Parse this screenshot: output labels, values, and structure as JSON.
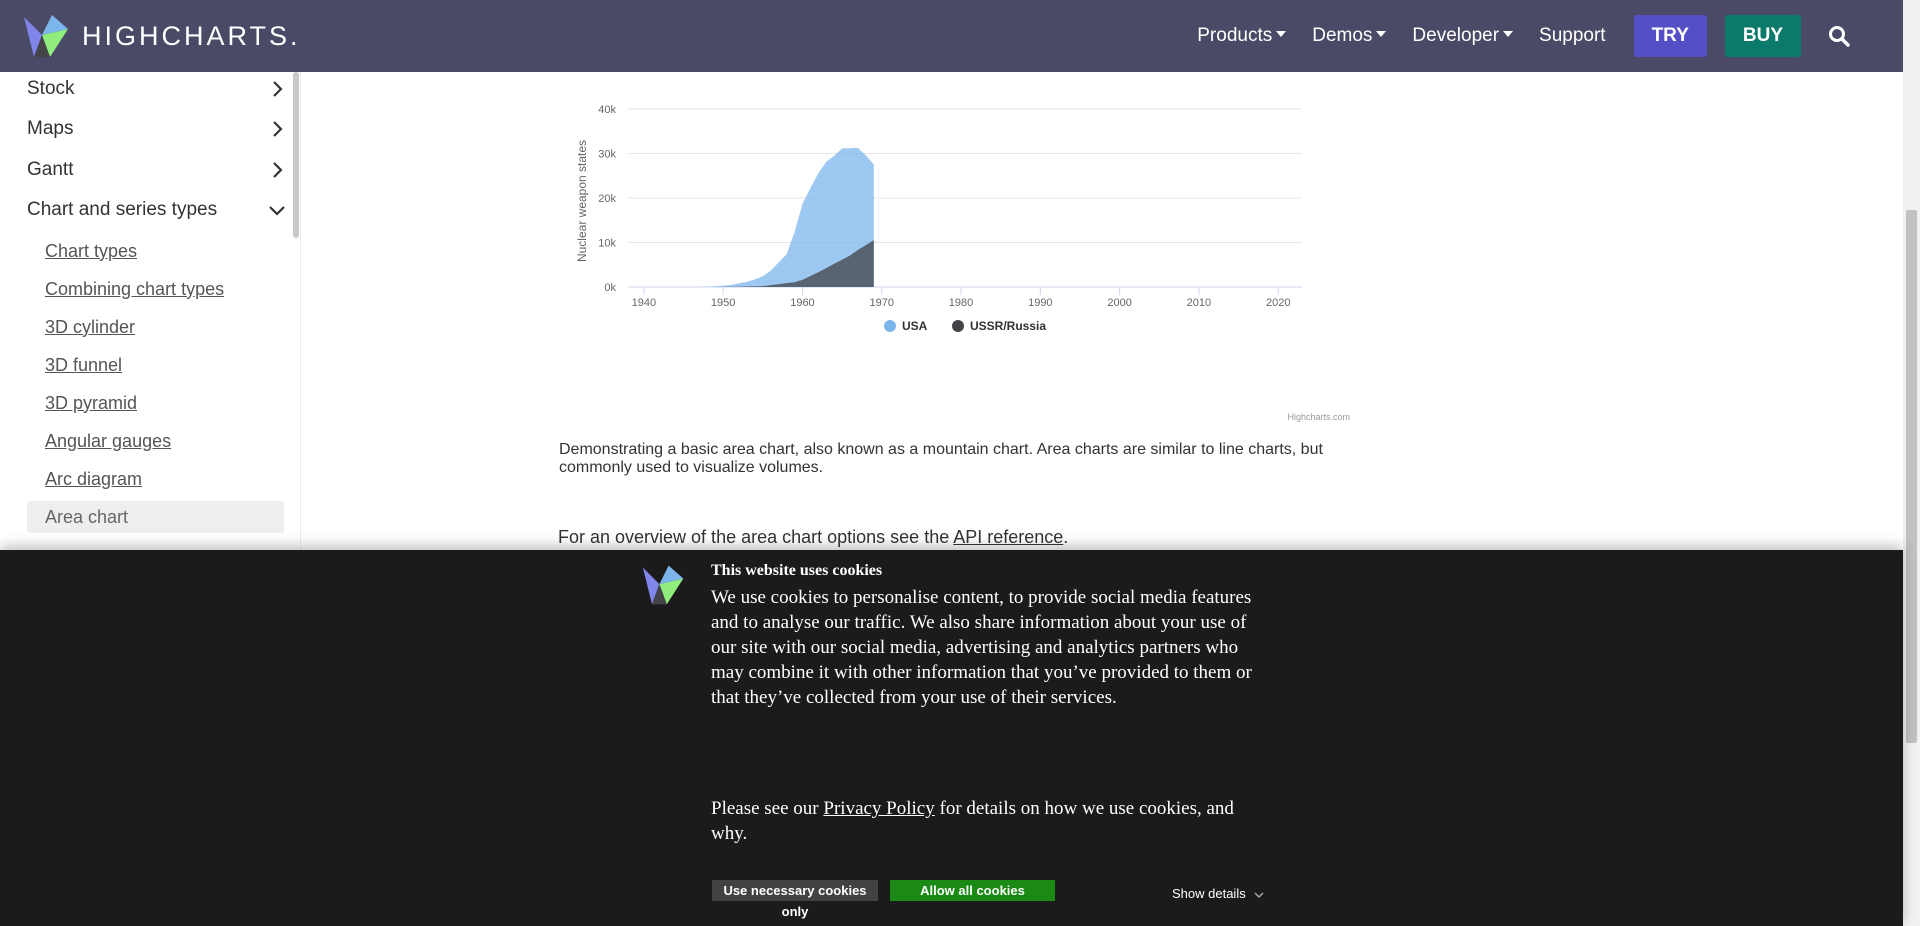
{
  "colors": {
    "nav_bg": "#4a4a67",
    "try_bg": "#544fc5",
    "buy_bg": "#0b7a6a",
    "cookie_bg": "#1b1b1b",
    "allow_bg": "#1a8a14",
    "usa": "#7cb5ec",
    "ussr": "#434348"
  },
  "header": {
    "logo_text": "HIGHCHARTS.",
    "nav": [
      {
        "label": "Products",
        "dropdown": true
      },
      {
        "label": "Demos",
        "dropdown": true
      },
      {
        "label": "Developer",
        "dropdown": true
      },
      {
        "label": "Support",
        "dropdown": false
      }
    ],
    "try_label": "TRY",
    "buy_label": "BUY",
    "search_icon": "search-icon"
  },
  "sidebar": {
    "top_items": [
      {
        "label": "Stock",
        "state": "collapsed"
      },
      {
        "label": "Maps",
        "state": "collapsed"
      },
      {
        "label": "Gantt",
        "state": "collapsed"
      },
      {
        "label": "Chart and series types",
        "state": "expanded"
      }
    ],
    "sub_items": [
      {
        "label": "Chart types"
      },
      {
        "label": "Combining chart types"
      },
      {
        "label": "3D cylinder"
      },
      {
        "label": "3D funnel"
      },
      {
        "label": "3D pyramid"
      },
      {
        "label": "Angular gauges"
      },
      {
        "label": "Arc diagram"
      },
      {
        "label": "Area chart",
        "active": true
      }
    ]
  },
  "chart_data": {
    "type": "area",
    "title": "",
    "xlabel": "",
    "ylabel": "Nuclear weapon states",
    "xlim": [
      1938,
      2023
    ],
    "ylim": [
      0,
      40000
    ],
    "x_ticks": [
      1940,
      1950,
      1960,
      1970,
      1980,
      1990,
      2000,
      2010,
      2020
    ],
    "y_ticks": [
      "0k",
      "10k",
      "20k",
      "30k",
      "40k"
    ],
    "y_tick_values": [
      0,
      10000,
      20000,
      30000,
      40000
    ],
    "legend_position": "bottom-center",
    "credits": "Highcharts.com",
    "series": [
      {
        "name": "USA",
        "x": [
          1944,
          1945,
          1946,
          1947,
          1948,
          1949,
          1950,
          1951,
          1952,
          1953,
          1954,
          1955,
          1956,
          1957,
          1958,
          1959,
          1960,
          1961,
          1962,
          1963,
          1964,
          1965,
          1966,
          1967,
          1968,
          1969
        ],
        "values": [
          0,
          2,
          9,
          13,
          50,
          170,
          298,
          438,
          841,
          1169,
          1703,
          2422,
          3692,
          5543,
          7345,
          12298,
          18638,
          22229,
          25540,
          28133,
          29463,
          31139,
          31175,
          31255,
          29561,
          27552
        ]
      },
      {
        "name": "USSR/Russia",
        "x": [
          1949,
          1950,
          1951,
          1952,
          1953,
          1954,
          1955,
          1956,
          1957,
          1958,
          1959,
          1960,
          1961,
          1962,
          1963,
          1964,
          1965,
          1966,
          1967,
          1968,
          1969
        ],
        "values": [
          1,
          5,
          25,
          50,
          120,
          150,
          200,
          426,
          660,
          869,
          1060,
          1605,
          2471,
          3322,
          4238,
          5221,
          6129,
          7089,
          8339,
          9399,
          10538
        ]
      }
    ]
  },
  "content": {
    "description": "Demonstrating a basic area chart, also known as a mountain chart. Area charts are similar to line charts, but commonly used to visualize volumes.",
    "overview_prefix": "For an overview of the area chart options see the ",
    "overview_link": "API reference",
    "overview_suffix": "."
  },
  "cookie": {
    "title": "This website uses cookies",
    "body": "We use cookies to personalise content, to provide social media features and to analyse our traffic. We also share information about your use of our site with our social media, advertising and analytics partners who may combine it with other information that you’ve provided to them or that they’ve collected from your use of their services.",
    "policy_prefix": "Please see our ",
    "policy_link": "Privacy Policy",
    "policy_suffix": " for details on how we use cookies, and why.",
    "necessary_label": "Use necessary cookies only",
    "allow_label": "Allow all cookies",
    "details_label": "Show details"
  }
}
